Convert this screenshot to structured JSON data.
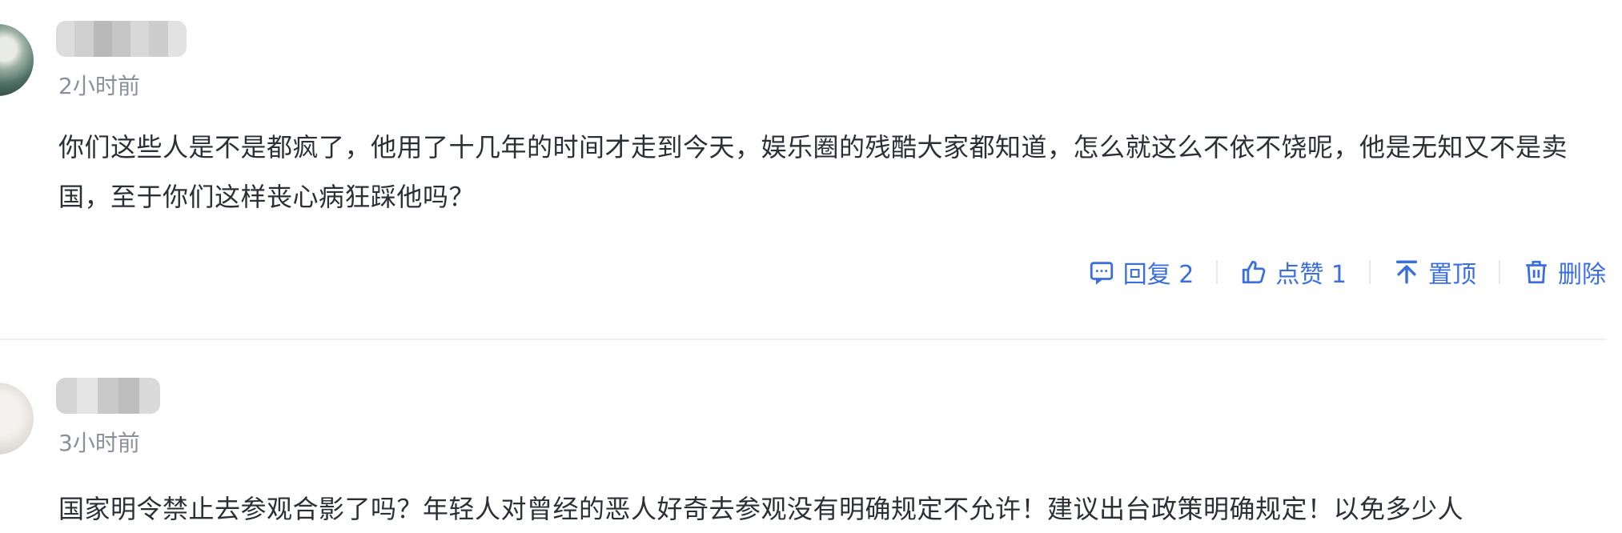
{
  "comments": [
    {
      "time": "2小时前",
      "text": "你们这些人是不是都疯了，他用了十几年的时间才走到今天，娱乐圈的残酷大家都知道，怎么就这么不依不饶呢，他是无知又不是卖国，至于你们这样丧心病狂踩他吗？",
      "actions": {
        "reply_label": "回复 2",
        "like_label": "点赞 1",
        "pin_label": "置顶",
        "delete_label": "删除"
      }
    },
    {
      "time": "3小时前",
      "text": "国家明令禁止去参观合影了吗？年轻人对曾经的恶人好奇去参观没有明确规定不允许！建议出台政策明确规定！以免多少人"
    }
  ],
  "colors": {
    "action_blue": "#3b6fe0",
    "text": "#2b2f36",
    "meta": "#8a8f99"
  },
  "icons": [
    "reply-icon",
    "thumbs-up-icon",
    "pin-top-icon",
    "trash-icon"
  ]
}
